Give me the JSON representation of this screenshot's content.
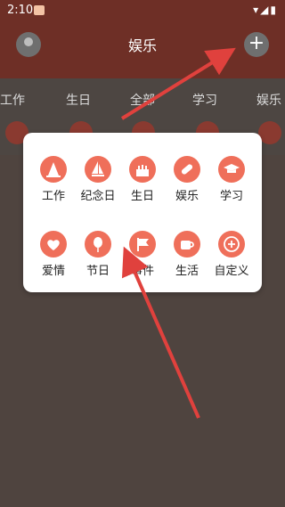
{
  "status_bar": {
    "time": "2:10",
    "notif_icon": "notification-icon",
    "right_icons": "▾◢▮"
  },
  "header": {
    "title": "娱乐"
  },
  "tabs": [
    "工作",
    "生日",
    "全部",
    "学习",
    "娱乐"
  ],
  "popup": {
    "row1": [
      {
        "label": "工作",
        "icon": "hat-icon"
      },
      {
        "label": "纪念日",
        "icon": "sailboat-icon"
      },
      {
        "label": "生日",
        "icon": "cake-icon"
      },
      {
        "label": "娱乐",
        "icon": "pill-icon"
      },
      {
        "label": "学习",
        "icon": "graduation-cap-icon"
      }
    ],
    "row2": [
      {
        "label": "爱情",
        "icon": "heart-icon"
      },
      {
        "label": "节日",
        "icon": "balloon-icon"
      },
      {
        "label": "事件",
        "icon": "flag-icon"
      },
      {
        "label": "生活",
        "icon": "cup-icon"
      },
      {
        "label": "自定义",
        "icon": "plus-icon"
      }
    ]
  },
  "colors": {
    "accent": "#ef6f5a",
    "header": "#6e2f26",
    "arrow": "#e0413d"
  }
}
